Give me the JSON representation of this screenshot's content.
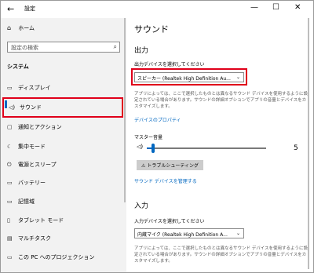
{
  "window": {
    "back_icon": "back-arrow-icon",
    "title": "設定",
    "controls": [
      "—",
      "☐",
      "✕"
    ]
  },
  "sidebar": {
    "home_label": "ホーム",
    "search_placeholder": "設定の検索",
    "section_label": "システム",
    "items": [
      {
        "label": "ディスプレイ",
        "icon": "display-icon",
        "glyph": "▭"
      },
      {
        "label": "サウンド",
        "icon": "speaker-icon",
        "glyph": "🔈",
        "active": true
      },
      {
        "label": "通知とアクション",
        "icon": "notification-icon",
        "glyph": "▢"
      },
      {
        "label": "集中モード",
        "icon": "moon-icon",
        "glyph": "☾"
      },
      {
        "label": "電源とスリープ",
        "icon": "power-icon",
        "glyph": "⏻"
      },
      {
        "label": "バッテリー",
        "icon": "battery-icon",
        "glyph": "▭"
      },
      {
        "label": "記憶域",
        "icon": "storage-icon",
        "glyph": "▭"
      },
      {
        "label": "タブレット モード",
        "icon": "tablet-icon",
        "glyph": "▯"
      },
      {
        "label": "マルチタスク",
        "icon": "multitask-icon",
        "glyph": "▤"
      },
      {
        "label": "この PC へのプロジェクション",
        "icon": "projection-icon",
        "glyph": "▭"
      }
    ]
  },
  "main": {
    "title": "サウンド",
    "output": {
      "heading": "出力",
      "select_label": "出力デバイスを選択してください",
      "selected_device": "スピーカー (Realtek High Definition Au...",
      "description": "アプリによっては、ここで選択したものとは異なるサウンド デバイスを使用するように設定されている場合があります。サウンドの詳細オプションでアプリの音量とデバイスをカスタマイズします。",
      "properties_link": "デバイスのプロパティ",
      "master_volume_label": "マスター音量",
      "volume_value": "5",
      "volume_fraction": 0.05,
      "troubleshoot_label": "トラブルシューティング",
      "manage_link": "サウンド デバイスを管理する"
    },
    "input": {
      "heading": "入力",
      "select_label": "入力デバイスを選択してください",
      "selected_device": "内蔵マイク (Realtek High Definition A...",
      "description": "アプリによっては、ここで選択したものとは異なるサウンド デバイスを使用するように設定されている場合があります。サウンドの詳細オプションでアプリの音量とデバイスをカスタマイズします。"
    }
  },
  "colors": {
    "accent": "#0067c0",
    "highlight": "#e0001a",
    "sidebar_bg": "#f2f2f2"
  }
}
